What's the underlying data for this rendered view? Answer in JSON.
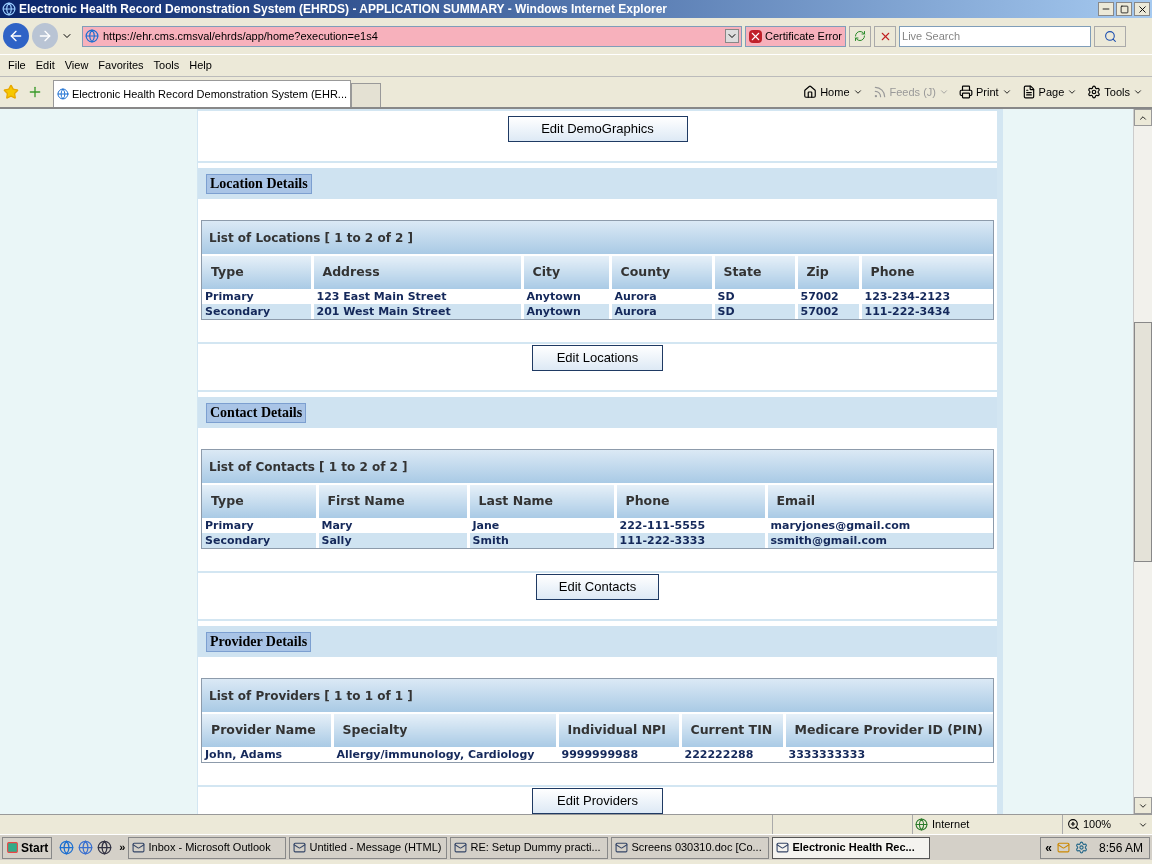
{
  "window": {
    "title": "Electronic Health Record Demonstration System (EHRDS) - APPLICATION SUMMARY - Windows Internet Explorer"
  },
  "address_bar": {
    "url": "https://ehr.cms.cmsval/ehrds/app/home?execution=e1s4",
    "certificate": "Certificate Error",
    "search_placeholder": "Live Search"
  },
  "menu": [
    "File",
    "Edit",
    "View",
    "Favorites",
    "Tools",
    "Help"
  ],
  "tab": {
    "title": "Electronic Health Record Demonstration System (EHR..."
  },
  "command_bar": [
    {
      "label": "Home",
      "disabled": false
    },
    {
      "label": "Feeds (J)",
      "disabled": true
    },
    {
      "label": "Print",
      "disabled": false
    },
    {
      "label": "Page",
      "disabled": false
    },
    {
      "label": "Tools",
      "disabled": false
    }
  ],
  "top_button": "Edit DemoGraphics",
  "sections": [
    {
      "title": "Location Details",
      "list_title": "List of Locations [ 1 to 2 of 2 ]",
      "columns": [
        "Type",
        "Address",
        "City",
        "County",
        "State",
        "Zip",
        "Phone"
      ],
      "rows": [
        [
          "Primary",
          "123 East Main Street",
          "Anytown",
          "Aurora",
          "SD",
          "57002",
          "123-234-2123"
        ],
        [
          "Secondary",
          "201 West Main Street",
          "Anytown",
          "Aurora",
          "SD",
          "57002",
          "111-222-3434"
        ]
      ],
      "button": "Edit Locations"
    },
    {
      "title": "Contact Details",
      "list_title": "List of Contacts [ 1 to 2 of 2 ]",
      "columns": [
        "Type",
        "First Name",
        "Last Name",
        "Phone",
        "Email"
      ],
      "rows": [
        [
          "Primary",
          "Mary",
          "Jane",
          "222-111-5555",
          "maryjones@gmail.com"
        ],
        [
          "Secondary",
          "Sally",
          "Smith",
          "111-222-3333",
          "ssmith@gmail.com"
        ]
      ],
      "button": "Edit Contacts"
    },
    {
      "title": "Provider Details",
      "list_title": "List of Providers [ 1 to 1 of 1 ]",
      "columns": [
        "Provider Name",
        "Specialty",
        "Individual NPI",
        "Current TIN",
        "Medicare Provider ID (PIN)"
      ],
      "rows": [
        [
          "John, Adams",
          "Allergy/immunology, Cardiology",
          "9999999988",
          "222222288",
          "3333333333"
        ]
      ],
      "button": "Edit Providers"
    }
  ],
  "status_bar": {
    "zone": "Internet",
    "zoom": "100%"
  },
  "taskbar": {
    "start": "Start",
    "more": "»",
    "tasks": [
      {
        "label": "Inbox - Microsoft Outlook",
        "selected": false
      },
      {
        "label": "Untitled - Message (HTML)",
        "selected": false
      },
      {
        "label": "RE: Setup Dummy practi...",
        "selected": false
      },
      {
        "label": "Screens 030310.doc [Co...",
        "selected": false
      },
      {
        "label": "Electronic Health Rec...",
        "selected": true
      }
    ],
    "tray_expand": "«",
    "time": "8:56 AM"
  }
}
